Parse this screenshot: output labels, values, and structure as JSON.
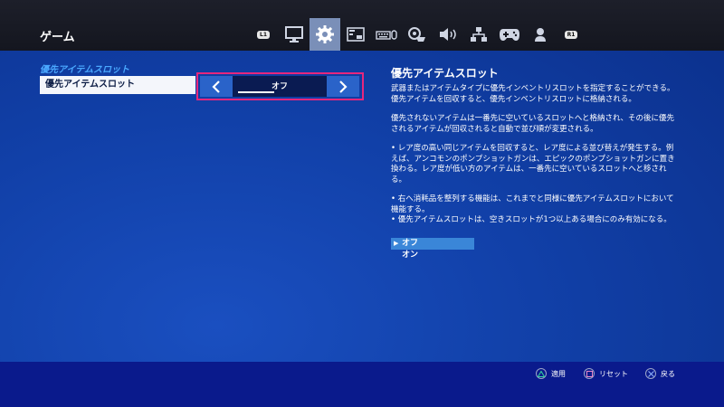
{
  "header": {
    "title": "ゲーム",
    "tabs": [
      {
        "icon": "l1-bumper-icon",
        "label": "L1"
      },
      {
        "icon": "monitor-icon"
      },
      {
        "icon": "gear-icon",
        "active": true
      },
      {
        "icon": "hud-icon"
      },
      {
        "icon": "keyboard-mouse-icon"
      },
      {
        "icon": "controller-settings-icon"
      },
      {
        "icon": "audio-icon"
      },
      {
        "icon": "network-icon"
      },
      {
        "icon": "gamepad-icon"
      },
      {
        "icon": "account-icon"
      },
      {
        "icon": "r1-bumper-icon",
        "label": "R1"
      }
    ]
  },
  "settings": {
    "section_title": "優先アイテムスロット",
    "row_label": "優先アイテムスロット",
    "value": "オフ"
  },
  "description": {
    "title": "優先アイテムスロット",
    "paragraphs": [
      "武器またはアイテムタイプに優先インベントリスロットを指定することができる。優先アイテムを回収すると、優先インベントリスロットに格納される。",
      "優先されないアイテムは一番先に空いているスロットへと格納され、その後に優先されるアイテムが回収されると自動で並び順が変更される。",
      "• レア度の高い同じアイテムを回収すると、レア度による並び替えが発生する。例えば、アンコモンのポンプショットガンは、エピックのポンプショットガンに置き換わる。レア度が低い方のアイテムは、一番先に空いているスロットへと移される。",
      "• 右へ消耗品を整列する機能は、これまでと同様に優先アイテムスロットにおいて機能する。\n• 優先アイテムスロットは、空きスロットが1つ以上ある場合にのみ有効になる。"
    ],
    "options": [
      {
        "label": "オフ",
        "selected": true
      },
      {
        "label": "オン",
        "selected": false
      }
    ]
  },
  "footer": {
    "hints": [
      {
        "button": "triangle-button-icon",
        "label": "適用"
      },
      {
        "button": "square-button-icon",
        "label": "リセット"
      },
      {
        "button": "cross-button-icon",
        "label": "戻る"
      }
    ]
  },
  "colors": {
    "accent_highlight": "#e6277d",
    "section_title": "#4aa8ff",
    "selected_option": "#3a86d8",
    "footer_bg": "#0a1a8c"
  }
}
